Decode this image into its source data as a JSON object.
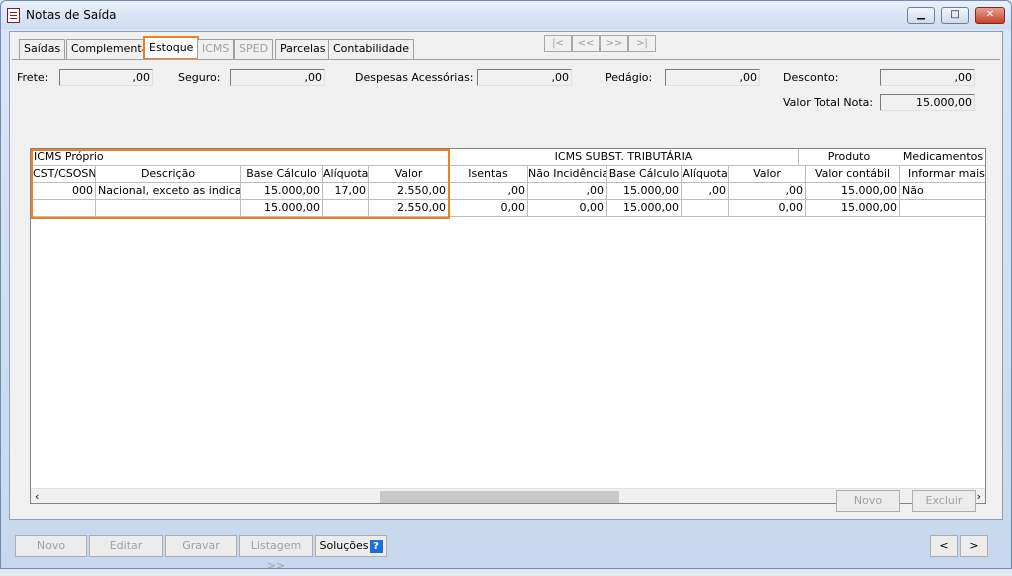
{
  "window": {
    "title": "Notas de Saída"
  },
  "tabs": [
    {
      "label": "Saídas",
      "state": "normal"
    },
    {
      "label": "Complementar",
      "state": "normal"
    },
    {
      "label": "Estoque",
      "state": "active"
    },
    {
      "label": "ICMS",
      "state": "disabled"
    },
    {
      "label": "SPED",
      "state": "disabled"
    },
    {
      "label": "Parcelas",
      "state": "normal"
    },
    {
      "label": "Contabilidade",
      "state": "normal"
    }
  ],
  "record_nav": {
    "first": "|<",
    "prev": "<<",
    "next": ">>",
    "last": ">|"
  },
  "totals": {
    "frete": {
      "label": "Frete:",
      "value": ",00"
    },
    "seguro": {
      "label": "Seguro:",
      "value": ",00"
    },
    "despesas": {
      "label": "Despesas Acessórias:",
      "value": ",00"
    },
    "pedagio": {
      "label": "Pedágio:",
      "value": ",00"
    },
    "desconto": {
      "label": "Desconto:",
      "value": ",00"
    },
    "valor_total": {
      "label": "Valor Total Nota:",
      "value": "15.000,00"
    }
  },
  "grid": {
    "groups": {
      "icms_proprio": "ICMS Próprio",
      "icms_st": "ICMS SUBST. TRIBUTÁRIA",
      "produto": "Produto",
      "medicamentos": "Medicamentos"
    },
    "columns": {
      "cst": "CST/CSOSN",
      "descricao": "Descrição",
      "base": "Base Cálculo",
      "aliquota": "Alíquota",
      "valor": "Valor",
      "isentas": "Isentas",
      "nao_incidencia": "Não Incidência",
      "st_base": "Base Cálculo",
      "st_aliquota": "Alíquota",
      "st_valor": "Valor",
      "valor_contabil": "Valor contábil",
      "informar": "Informar mais d"
    },
    "rows": [
      {
        "cst": "000",
        "descricao": "Nacional, exceto as indicadas",
        "base": "15.000,00",
        "aliquota": "17,00",
        "valor": "2.550,00",
        "isentas": ",00",
        "nao_incidencia": ",00",
        "st_base": "15.000,00",
        "st_aliquota": ",00",
        "st_valor": ",00",
        "valor_contabil": "15.000,00",
        "informar": "Não"
      }
    ],
    "totals_row": {
      "base": "15.000,00",
      "valor": "2.550,00",
      "isentas": "0,00",
      "nao_incidencia": "0,00",
      "st_base": "15.000,00",
      "st_valor": "0,00",
      "valor_contabil": "15.000,00"
    }
  },
  "grid_buttons": {
    "novo": "Novo",
    "excluir": "Excluir"
  },
  "footer": {
    "novo": "Novo",
    "editar": "Editar",
    "gravar": "Gravar",
    "listagem": "Listagem >>",
    "solucoes": "Soluções",
    "prev": "<",
    "next": ">"
  }
}
